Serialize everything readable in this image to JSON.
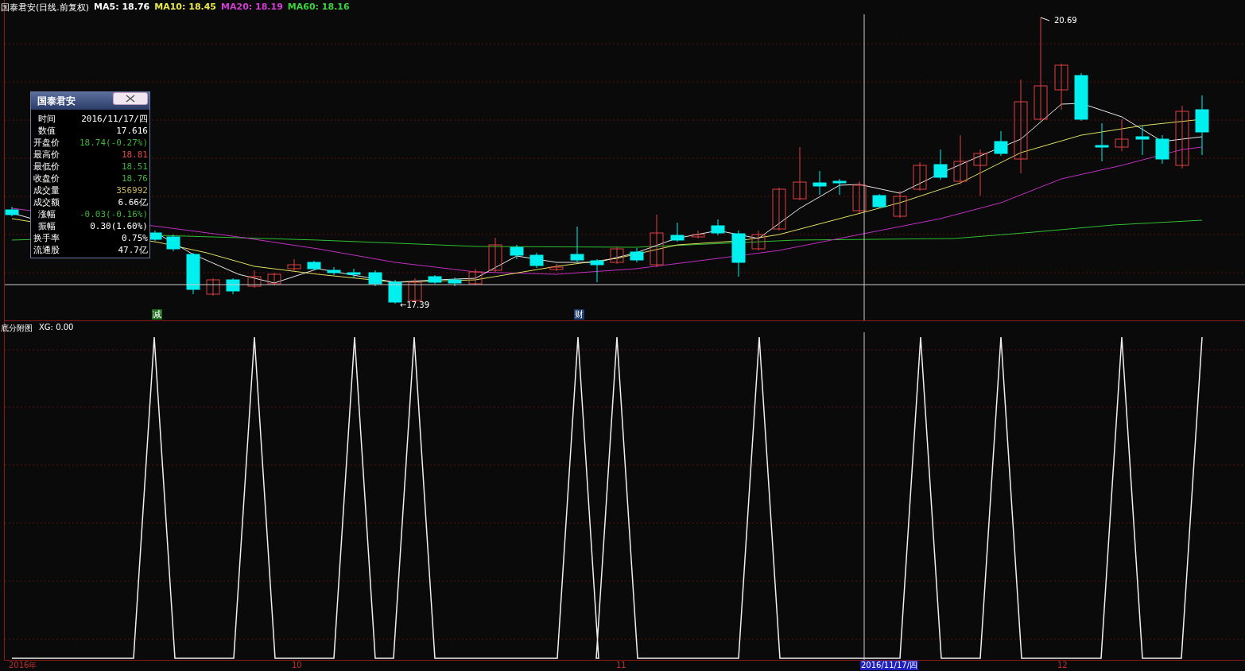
{
  "header": {
    "title": "国泰君安(日线.前复权)",
    "indicators": [
      {
        "label": "MA5: 18.76",
        "color": "#ffffff"
      },
      {
        "label": "MA10: 18.45",
        "color": "#e8e84a"
      },
      {
        "label": "MA20: 18.19",
        "color": "#d43cd4"
      },
      {
        "label": "MA60: 18.16",
        "color": "#3cd43c"
      }
    ]
  },
  "info_popup": {
    "title": "国泰君安",
    "rows": [
      {
        "label": "时间",
        "value": "2016/11/17/四",
        "color": "#ffffff"
      },
      {
        "label": "数值",
        "value": "17.616",
        "color": "#ffffff"
      },
      {
        "label": "开盘价",
        "value": "18.74(-0.27%)",
        "color": "#3cb43c"
      },
      {
        "label": "最高价",
        "value": "18.81",
        "color": "#e04848"
      },
      {
        "label": "最低价",
        "value": "18.51",
        "color": "#3cb43c"
      },
      {
        "label": "收盘价",
        "value": "18.76",
        "color": "#3cb43c"
      },
      {
        "label": "成交量",
        "value": "356992",
        "color": "#c8b45a"
      },
      {
        "label": "成交额",
        "value": "6.66亿",
        "color": "#ffffff"
      },
      {
        "label": "涨幅",
        "value": "-0.03(-0.16%)",
        "color": "#3cb43c"
      },
      {
        "label": "振幅",
        "value": "0.30(1.60%)",
        "color": "#ffffff"
      },
      {
        "label": "换手率",
        "value": "0.75%",
        "color": "#ffffff"
      },
      {
        "label": "流通股",
        "value": "47.7亿",
        "color": "#ffffff"
      }
    ]
  },
  "price_marks": [
    {
      "label": "20.69",
      "kind": "high"
    },
    {
      "label": "←17.39",
      "kind": "low"
    }
  ],
  "event_marks": [
    {
      "label": "减",
      "color": "#1e6e1e"
    },
    {
      "label": "财",
      "color": "#1e3c6e"
    }
  ],
  "sub_chart": {
    "name": "底分附图",
    "reading": "XG: 0.00"
  },
  "x_axis": [
    {
      "label": "2016年",
      "selected": false
    },
    {
      "label": "10",
      "selected": false
    },
    {
      "label": "11",
      "selected": false
    },
    {
      "label": "2016/11/17/四",
      "selected": true
    },
    {
      "label": "12",
      "selected": false
    }
  ]
}
